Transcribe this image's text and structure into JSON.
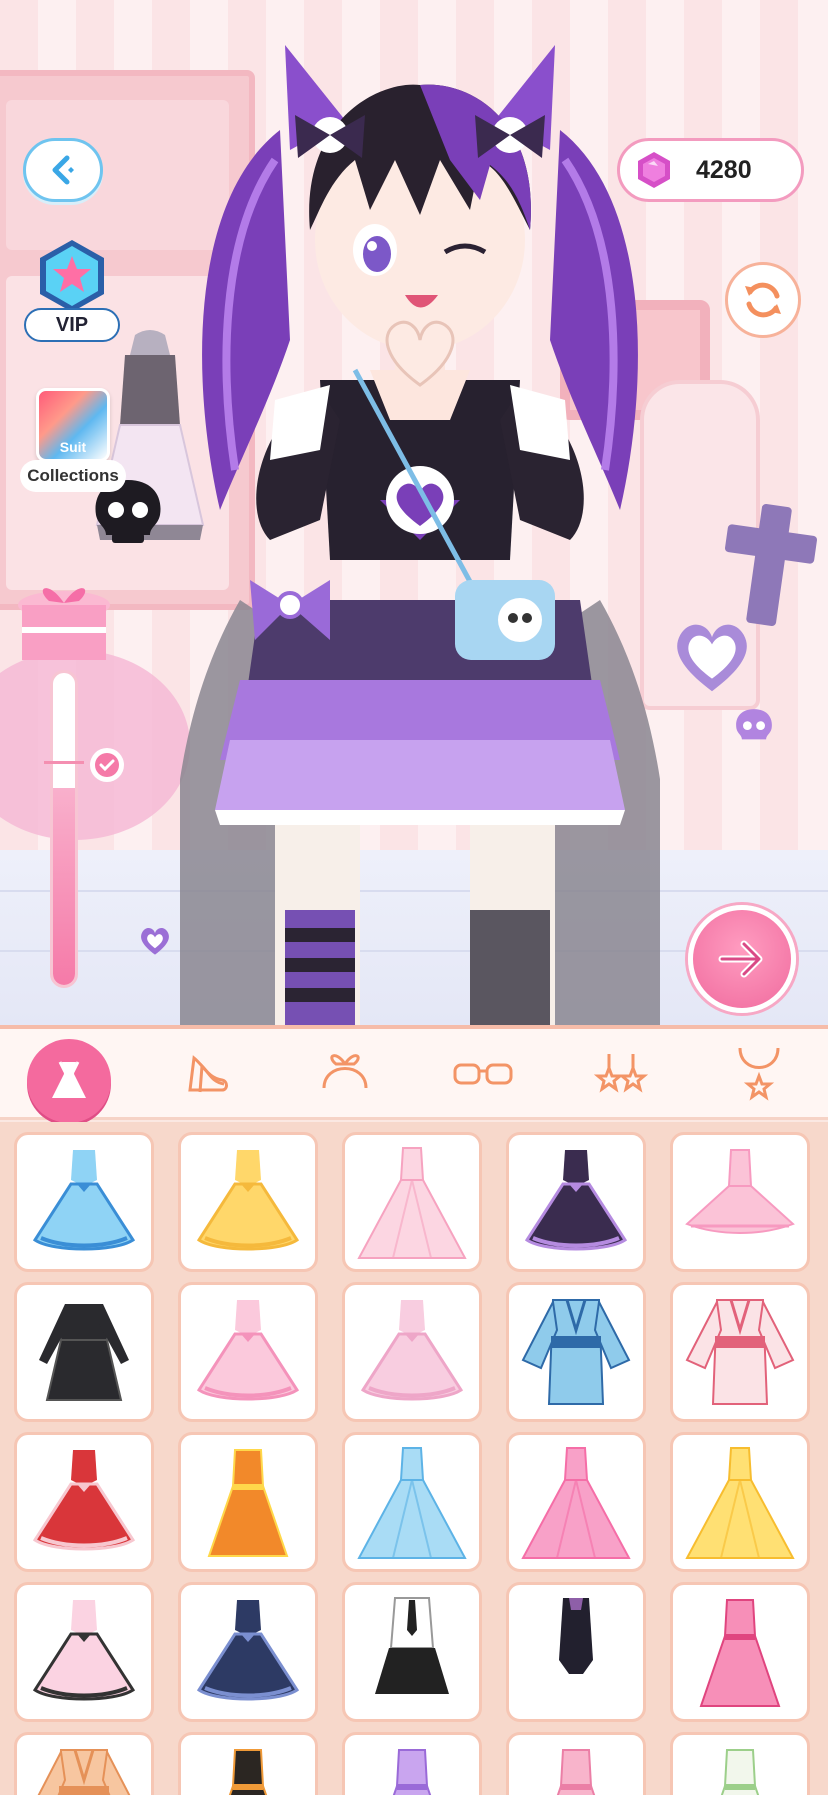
{
  "currency": {
    "icon": "gem-icon",
    "amount": "4280"
  },
  "vip": {
    "label": "VIP"
  },
  "suit": {
    "label": "Suit"
  },
  "collections": {
    "label": "Collections"
  },
  "meter": {
    "level_fraction": 0.63
  },
  "categories": [
    {
      "name": "dress",
      "icon": "dress-icon",
      "active": true
    },
    {
      "name": "shoes",
      "icon": "shoes-icon",
      "active": false
    },
    {
      "name": "headband",
      "icon": "headband-icon",
      "active": false
    },
    {
      "name": "glasses",
      "icon": "glasses-icon",
      "active": false
    },
    {
      "name": "earrings",
      "icon": "earrings-icon",
      "active": false
    },
    {
      "name": "necklace",
      "icon": "necklace-icon",
      "active": false
    }
  ],
  "colors": {
    "accent_pink": "#f46a9e",
    "back_button_border": "#6fc4ef",
    "grid_background": "#f7d8cb"
  },
  "dresses": [
    {
      "name": "blue-bow-dress",
      "main": "#8fd3f5",
      "accent": "#3a8ed6",
      "style": "puffy"
    },
    {
      "name": "yellow-jacket-dress",
      "main": "#ffd76a",
      "accent": "#f5b93c",
      "style": "puffy"
    },
    {
      "name": "pink-train-dress",
      "main": "#fcd6e2",
      "accent": "#f6a3c0",
      "style": "gown"
    },
    {
      "name": "purple-gothic-dress",
      "main": "#3a2c4f",
      "accent": "#b58be0",
      "style": "puffy"
    },
    {
      "name": "pink-tutu-dress",
      "main": "#fbc3d7",
      "accent": "#f79ac0",
      "style": "tutu"
    },
    {
      "name": "black-long-sleeve-dress",
      "main": "#2a2a2e",
      "accent": "#555",
      "style": "sleeve"
    },
    {
      "name": "pink-ruffle-dress",
      "main": "#fbc9dc",
      "accent": "#f493bb",
      "style": "puffy"
    },
    {
      "name": "pink-puff-dress",
      "main": "#f8cde0",
      "accent": "#eea6c8",
      "style": "puffy"
    },
    {
      "name": "blue-kimono",
      "main": "#8fcbeb",
      "accent": "#2e6aa8",
      "style": "kimono"
    },
    {
      "name": "floral-kimono",
      "main": "#fbe3e6",
      "accent": "#e2627a",
      "style": "kimono"
    },
    {
      "name": "red-christmas-dress",
      "main": "#d9363a",
      "accent": "#f7c7cf",
      "style": "puffy"
    },
    {
      "name": "orange-dress",
      "main": "#f2892a",
      "accent": "#ffd84a",
      "style": "aline"
    },
    {
      "name": "blue-ball-gown",
      "main": "#a9dcf5",
      "accent": "#5db3e6",
      "style": "gown"
    },
    {
      "name": "pink-ball-gown",
      "main": "#f8a1c8",
      "accent": "#f56ea7",
      "style": "gown"
    },
    {
      "name": "yellow-ball-gown",
      "main": "#ffe073",
      "accent": "#f7bd2f",
      "style": "gown"
    },
    {
      "name": "pink-maid-dress",
      "main": "#fbd3e2",
      "accent": "#333",
      "style": "puffy"
    },
    {
      "name": "navy-gothic-dress",
      "main": "#2d3a64",
      "accent": "#7b8fd0",
      "style": "puffy"
    },
    {
      "name": "school-uniform",
      "main": "#ffffff",
      "accent": "#222",
      "style": "uniform"
    },
    {
      "name": "black-bodysuit",
      "main": "#22202e",
      "accent": "#8e5fa8",
      "style": "body"
    },
    {
      "name": "pink-cheongsam",
      "main": "#f78fb8",
      "accent": "#e0457f",
      "style": "aline"
    },
    {
      "name": "peach-kimono",
      "main": "#f7c6a0",
      "accent": "#e59158",
      "style": "kimono"
    },
    {
      "name": "black-orange-top",
      "main": "#2b2622",
      "accent": "#f09a38",
      "style": "aline"
    },
    {
      "name": "lavender-dress",
      "main": "#c9a5ef",
      "accent": "#9a6ad8",
      "style": "aline"
    },
    {
      "name": "pink-frill-dress",
      "main": "#f8b4cb",
      "accent": "#eb7fa6",
      "style": "aline"
    },
    {
      "name": "green-white-dress",
      "main": "#f2f7ec",
      "accent": "#9ccf8a",
      "style": "aline"
    }
  ]
}
